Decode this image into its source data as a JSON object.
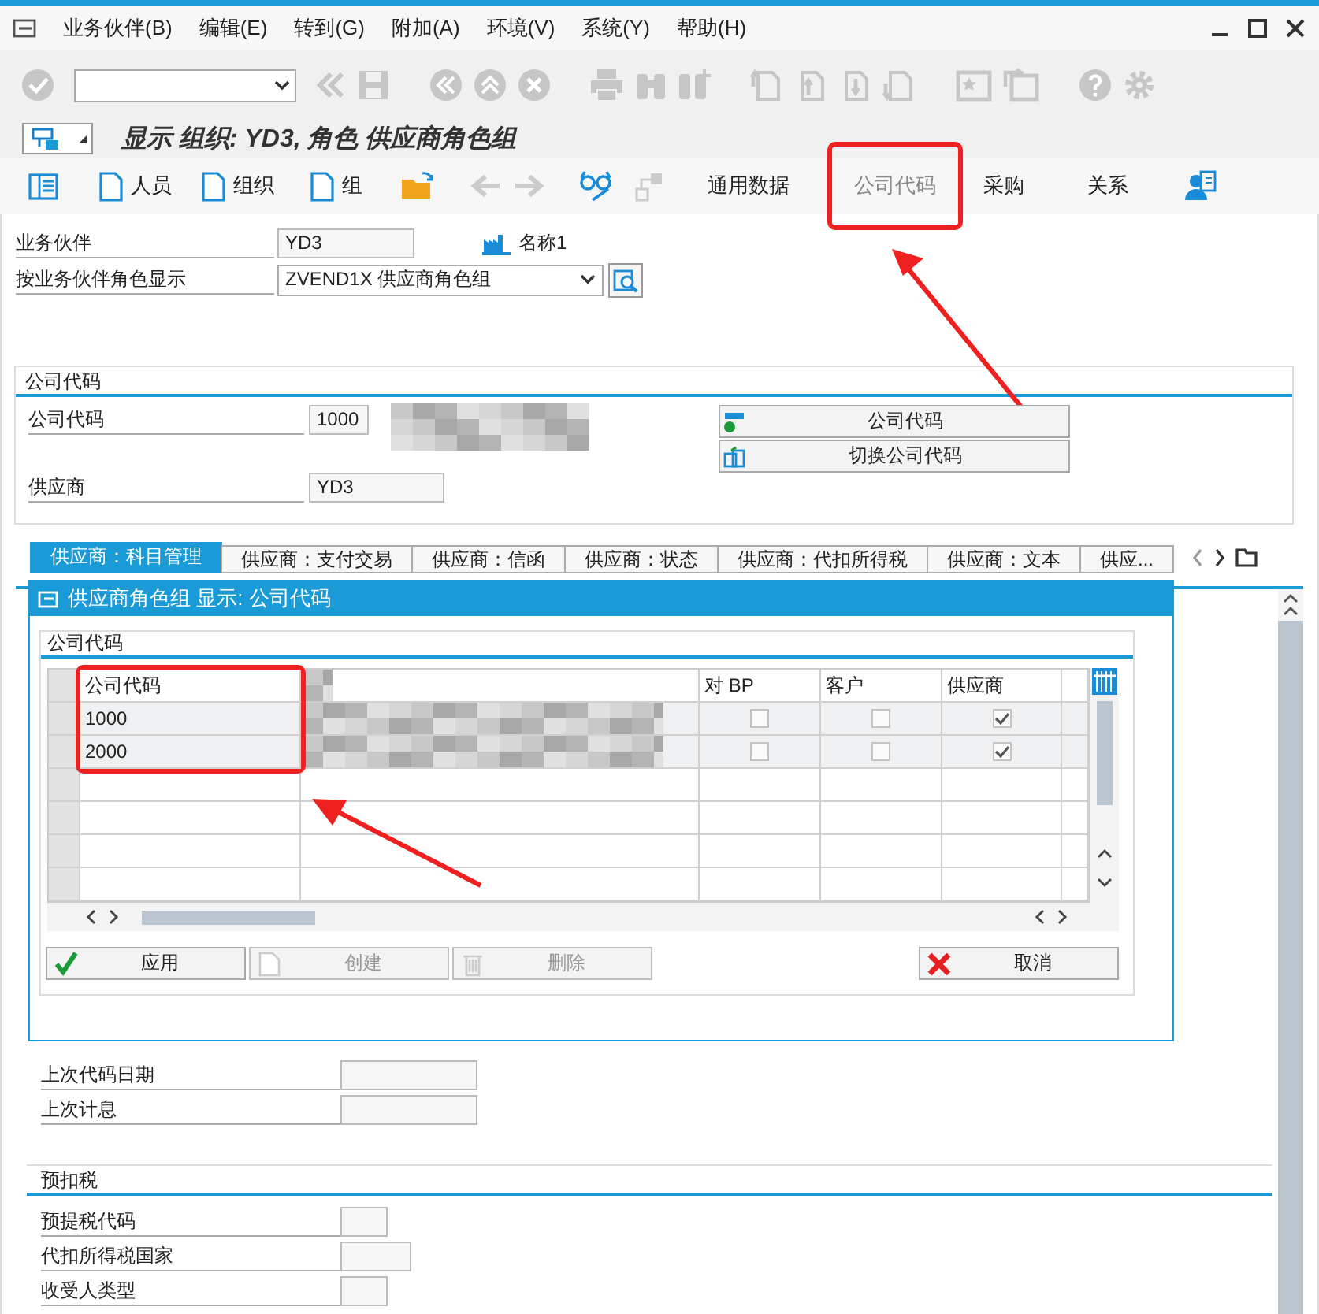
{
  "menu_bar": {
    "items": [
      "业务伙伴(B)",
      "编辑(E)",
      "转到(G)",
      "附加(A)",
      "环境(V)",
      "系统(Y)",
      "帮助(H)"
    ]
  },
  "title": "显示 组织: YD3, 角色 供应商角色组",
  "app_toolbar": {
    "create_buttons": [
      "人员",
      "组织",
      "组"
    ],
    "views": [
      {
        "label": "通用数据",
        "disabled": false,
        "highlighted": false
      },
      {
        "label": "公司代码",
        "disabled": true,
        "highlighted": true
      },
      {
        "label": "采购",
        "disabled": false,
        "highlighted": false
      },
      {
        "label": "关系",
        "disabled": false,
        "highlighted": false
      }
    ]
  },
  "header": {
    "partner_label": "业务伙伴",
    "partner_value": "YD3",
    "name_label": "名称1",
    "role_label": "按业务伙伴角色显示",
    "role_value": "ZVEND1X 供应商角色组"
  },
  "company_group": {
    "title": "公司代码",
    "code_label": "公司代码",
    "code_value": "1000",
    "vendor_label": "供应商",
    "vendor_value": "YD3",
    "buttons": [
      "公司代码",
      "切换公司代码"
    ]
  },
  "tabs": [
    {
      "label": "供应商：科目管理",
      "selected": true
    },
    {
      "label": "供应商：支付交易",
      "selected": false
    },
    {
      "label": "供应商：信函",
      "selected": false
    },
    {
      "label": "供应商：状态",
      "selected": false
    },
    {
      "label": "供应商：代扣所得税",
      "selected": false
    },
    {
      "label": "供应商：文本",
      "selected": false
    },
    {
      "label": "供应...",
      "selected": false
    }
  ],
  "tab_content": {
    "rows": [
      {
        "label": "上次代码日期",
        "kind": "long"
      },
      {
        "label": "上次计息",
        "kind": "long"
      }
    ],
    "withholding": {
      "title": "预扣税",
      "rows": [
        {
          "label": "预提税代码",
          "kind": "short"
        },
        {
          "label": "代扣所得税国家",
          "kind": "medium"
        },
        {
          "label": "收受人类型",
          "kind": "short"
        }
      ]
    }
  },
  "dialog": {
    "title": "供应商角色组 显示: 公司代码",
    "group_title": "公司代码",
    "highlight_first_column": true,
    "columns": [
      {
        "label": "公司代码"
      },
      {
        "kind": "redacted"
      },
      {
        "label": "对 BP"
      },
      {
        "label": "客户"
      },
      {
        "label": "供应商"
      }
    ],
    "rows": [
      {
        "company_code": "1000",
        "for_bp": false,
        "customer": false,
        "vendor": true
      },
      {
        "company_code": "2000",
        "for_bp": false,
        "customer": false,
        "vendor": true
      }
    ],
    "buttons": [
      {
        "label": "应用",
        "kind": "apply",
        "disabled": false
      },
      {
        "label": "创建",
        "kind": "create",
        "disabled": true
      },
      {
        "label": "删除",
        "kind": "delete",
        "disabled": true
      },
      {
        "label": "取消",
        "kind": "cancel",
        "disabled": false
      }
    ]
  }
}
